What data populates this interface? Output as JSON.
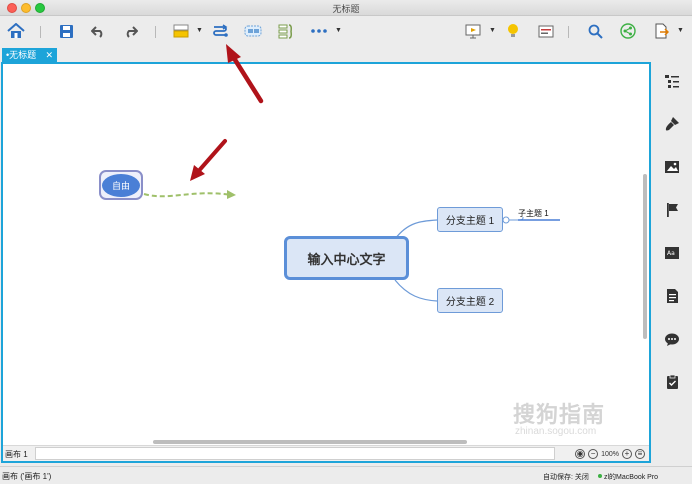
{
  "window": {
    "title": "无标题"
  },
  "tab": {
    "label": "•无标题",
    "close": "✕"
  },
  "mindmap": {
    "central": "输入中心文字",
    "branches": [
      "分支主题 1",
      "分支主题 2"
    ],
    "subtopic": "子主题 1",
    "floating": "自由"
  },
  "sheetbar": {
    "sheet_tab": "画布 1",
    "zoom": "100%"
  },
  "statusbar": {
    "left": "画布 ('画布 1')",
    "autosave": "自动保存: 关闭",
    "user": "zl的MacBook Pro"
  },
  "watermark": {
    "text": "搜狗指南",
    "url": "zhinan.sogou.com"
  },
  "colors": {
    "accent": "#1da4d9",
    "node_fill": "#dbe6f6",
    "node_border": "#5b8fd8",
    "arrow": "#b0131a",
    "floating_fill": "#4a7fd6",
    "relationship": "#9fc06a"
  },
  "icons": {
    "toolbar": [
      "home-icon",
      "save-icon",
      "undo-icon",
      "redo-icon",
      "topic-style-icon",
      "relationship-icon",
      "boundary-icon",
      "summary-icon",
      "more-icon",
      "presentation-icon",
      "idea-icon",
      "outline-icon",
      "search-icon",
      "share-icon",
      "export-icon"
    ],
    "sidebar": [
      "outline-panel-icon",
      "format-brush-icon",
      "image-icon",
      "marker-flag-icon",
      "text-style-icon",
      "notes-icon",
      "comment-icon",
      "task-icon"
    ]
  }
}
